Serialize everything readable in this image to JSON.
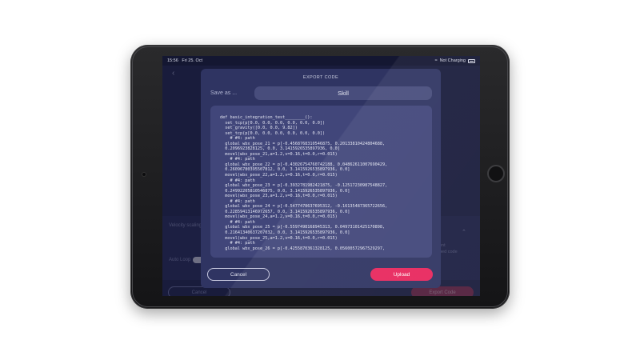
{
  "status_bar": {
    "time": "15:56",
    "date": "Fri 25. Oct",
    "battery_text": "Not Charging"
  },
  "background": {
    "back_glyph": "‹",
    "velocity_label": "Velocity scaling",
    "auto_label": "Auto Loop",
    "hint_text_1": "ent",
    "hint_text_2": "ped code",
    "cancel_label": "Cancel",
    "export_label": "Export Code"
  },
  "modal": {
    "title": "EXPORT CODE",
    "save_as_label": "Save as ...",
    "save_as_value": "Skill",
    "code": "def basic_integration_test________():\n  set_tcp(p[0.0, 0.0, 0.0, 0.0, 0.0, 0.0])\n  set_gravity([0.0, 0.0, 9.82])\n  set_tcp(p[0.0, 0.0, 0.0, 0.0, 0.0, 0.0])\n    # #4: path\n  global wbx_pose_21 = p[-0.4568768310546875, 0.20133810424804688,\n  0.2096923828125, 0.0, 3.1415926535897936, 0.0]\n  movel(wbx_pose_21,a=1.2,v=0.16,t=0.0,r=0.015)\n    # #4: path\n  global wbx_pose_22 = p[-0.43026754760742188, 0.04862611007690429,\n  0.26096780395507812, 0.0, 3.1415926535897936, 0.0]\n  movel(wbx_pose_22,a=1.2,v=0.16,t=0.0,r=0.015)\n    # #4: path\n  global wbx_pose_23 = p[-0.3932781982421875, -0.12517230987548827,\n  0.24992205810546875, 0.0, 3.1415926535897936, 0.0]\n  movel(wbx_pose_23,a=1.2,v=0.16,t=0.0,r=0.015)\n    # #4: path\n  global wbx_pose_24 = p[-0.5477478637695312, -0.16135487365722656,\n  0.22859413146972657, 0.0, 3.1415926535897936, 0.0]\n  movel(wbx_pose_24,a=1.2,v=0.16,t=0.0,r=0.015)\n    # #4: path\n  global wbx_pose_25 = p[-0.5597498168945313, 0.04973101425170898,\n  0.21641340637207032, 0.0, 3.1415926535897936, 0.0]\n  movel(wbx_pose_25,a=1.2,v=0.16,t=0.0,r=0.015)\n    # #4: path\n  global wbx_pose_26 = p[-0.4255870361328125, 0.05600572967529297,",
    "cancel_label": "Cancel",
    "upload_label": "Upload"
  },
  "colors": {
    "accent": "#e8275d",
    "screen_bg": "#1d2142",
    "modal_bg": "#2f3462"
  }
}
